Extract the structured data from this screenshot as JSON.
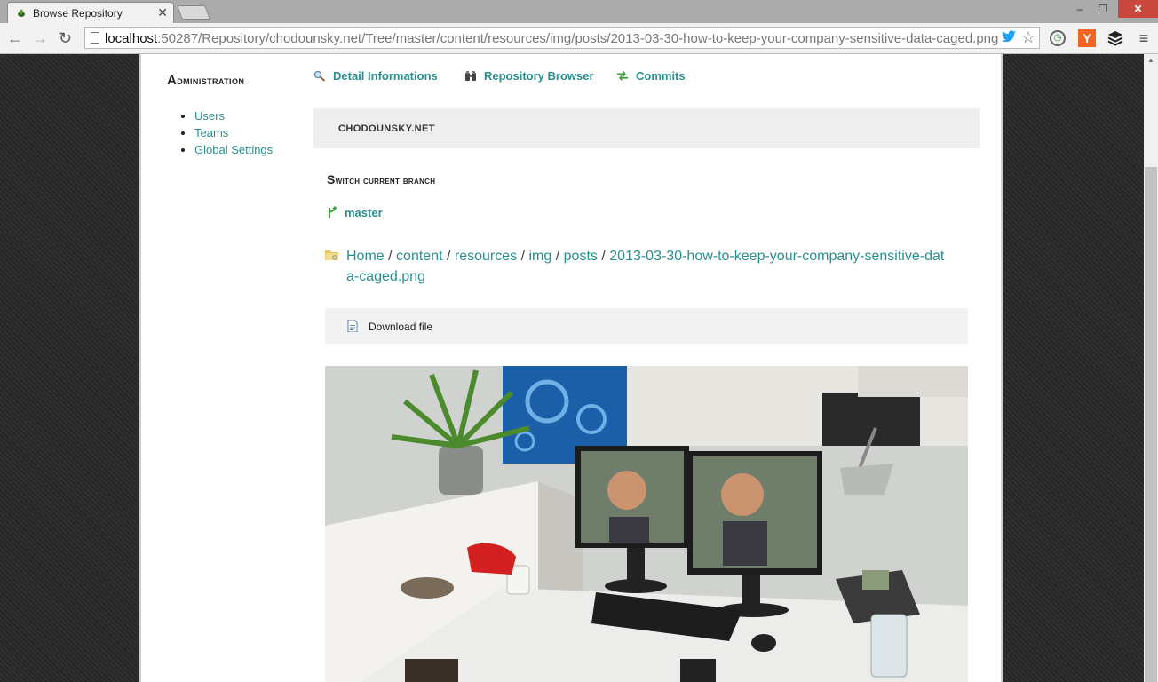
{
  "browser": {
    "tab_title": "Browse Repository",
    "tab_close": "✕",
    "url_host": "localhost",
    "url_rest": ":50287/Repository/chodounsky.net/Tree/master/content/resources/img/posts/2013-03-30-how-to-keep-your-company-sensitive-data-caged.png",
    "window_min": "–",
    "window_max": "❐",
    "window_close": "✕",
    "back": "←",
    "forward": "→",
    "reload": "↻",
    "bookmark_star": "☆",
    "ext_y_label": "Y",
    "menu_glyph": "≡",
    "icons": [
      "page-icon",
      "twitter-icon",
      "star-icon",
      "clock-icon",
      "y-icon",
      "buffer-icon",
      "menu-icon"
    ]
  },
  "sidebar": {
    "title_first": "A",
    "title_rest": "dministration",
    "items": [
      {
        "label": "Users"
      },
      {
        "label": "Teams"
      },
      {
        "label": "Global Settings"
      }
    ]
  },
  "topnav": {
    "detail": "Detail Informations",
    "browser": "Repository Browser",
    "commits": "Commits"
  },
  "repo": {
    "name": "CHODOUNSKY.NET"
  },
  "branch": {
    "title_first": "S",
    "title_rest": "witch current branch",
    "current": "master"
  },
  "breadcrumb": {
    "items": [
      "Home",
      "content",
      "resources",
      "img",
      "posts",
      "2013-03-30-how-to-keep-your-company-sensitive-data-caged.png"
    ],
    "separator": "/"
  },
  "file": {
    "download_label": "Download file"
  },
  "colors": {
    "accent": "#2a8f8f",
    "close_button": "#c9473d"
  }
}
